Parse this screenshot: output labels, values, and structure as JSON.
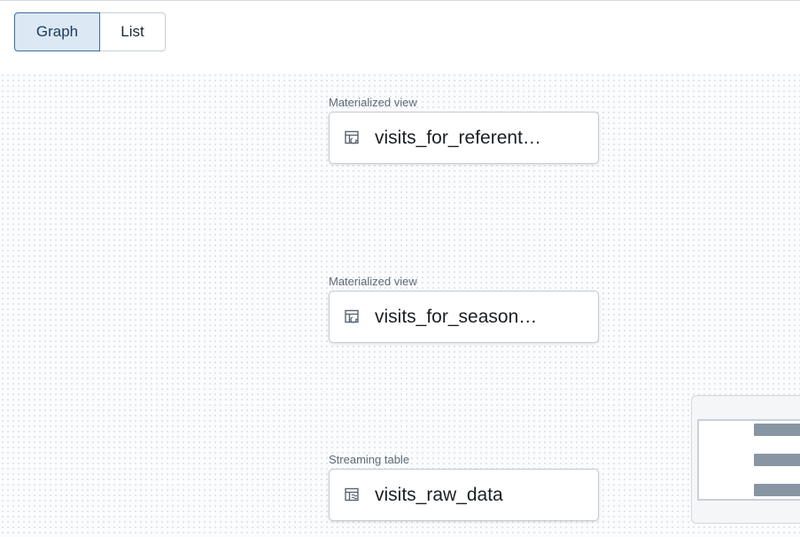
{
  "view_toggle": {
    "graph_label": "Graph",
    "list_label": "List",
    "selected": "Graph"
  },
  "graph": {
    "nodes": [
      {
        "type": "Materialized view",
        "name": "visits_for_referent…"
      },
      {
        "type": "Materialized view",
        "name": "visits_for_season…"
      },
      {
        "type": "Streaming table",
        "name": "visits_raw_data"
      }
    ]
  },
  "colors": {
    "selected_bg": "#dce8f4",
    "selected_border": "#3d6e9f",
    "minimap_node": "#8896a3"
  }
}
